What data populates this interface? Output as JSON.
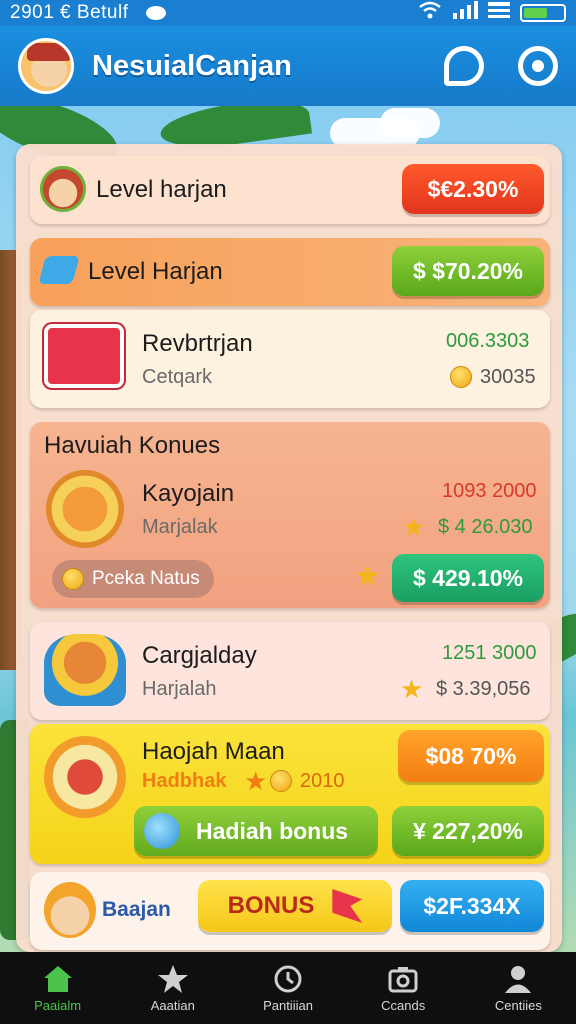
{
  "status_bar": {
    "time": "2901 € Betulf"
  },
  "header": {
    "title": "NesuialCanjan"
  },
  "cards": [
    {
      "title": "Level harjan",
      "value": "$€2.30%"
    },
    {
      "title": "Level Harjan",
      "value": "$ $70.20%"
    },
    {
      "title": "Revbrtrjan",
      "subtitle": "Cetqark",
      "value_top": "006.3303",
      "value_bottom": "30035"
    },
    {
      "section_title": "Havuiah Konues",
      "title": "Kayojain",
      "subtitle": "Marjalak",
      "value_top": "1093 2000",
      "value_bottom": "$ 4 26.030",
      "chip": "Pceka Natus",
      "button": "$ 429.10%"
    },
    {
      "title": "Cargjalday",
      "subtitle": "Harjalah",
      "value_top": "1251 3000",
      "value_bottom": "$ 3.39,056"
    },
    {
      "title": "Haojah Maan",
      "subtitle": "Hadbhak",
      "points": "2010",
      "button_top": "$08 70%",
      "bonus_label": "Hadiah bonus",
      "button_bottom": "¥ 227,20%"
    },
    {
      "small_label": "Baajan",
      "button_bonus": "BONUS",
      "value": "$2F.334X"
    }
  ],
  "nav": [
    {
      "label": "Paaialm",
      "icon": "home-icon"
    },
    {
      "label": "Aaatian",
      "icon": "star-icon"
    },
    {
      "label": "Pantiiian",
      "icon": "clock-icon"
    },
    {
      "label": "Ccands",
      "icon": "camera-icon"
    },
    {
      "label": "Centiies",
      "icon": "user-icon"
    }
  ]
}
